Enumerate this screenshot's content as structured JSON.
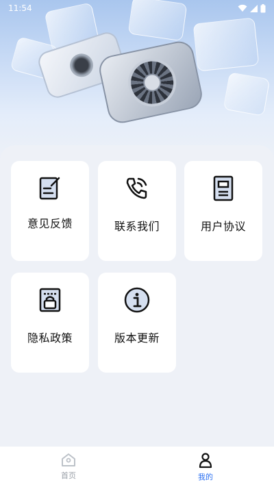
{
  "status_bar": {
    "time": "11:54"
  },
  "menu": {
    "items": [
      {
        "label": "意见反馈",
        "icon": "feedback-edit-icon"
      },
      {
        "label": "联系我们",
        "icon": "phone-call-icon"
      },
      {
        "label": "用户协议",
        "icon": "agreement-document-icon"
      },
      {
        "label": "隐私政策",
        "icon": "privacy-lock-icon"
      },
      {
        "label": "版本更新",
        "icon": "info-icon"
      }
    ]
  },
  "tab_bar": {
    "tabs": [
      {
        "label": "首页",
        "icon": "home-icon",
        "active": false
      },
      {
        "label": "我的",
        "icon": "user-icon",
        "active": true
      }
    ],
    "active_color": "#2b6ff0",
    "inactive_color": "#9aa0a8"
  },
  "colors": {
    "background": "#eef1f7",
    "card": "#ffffff",
    "accent": "#2b6ff0"
  }
}
